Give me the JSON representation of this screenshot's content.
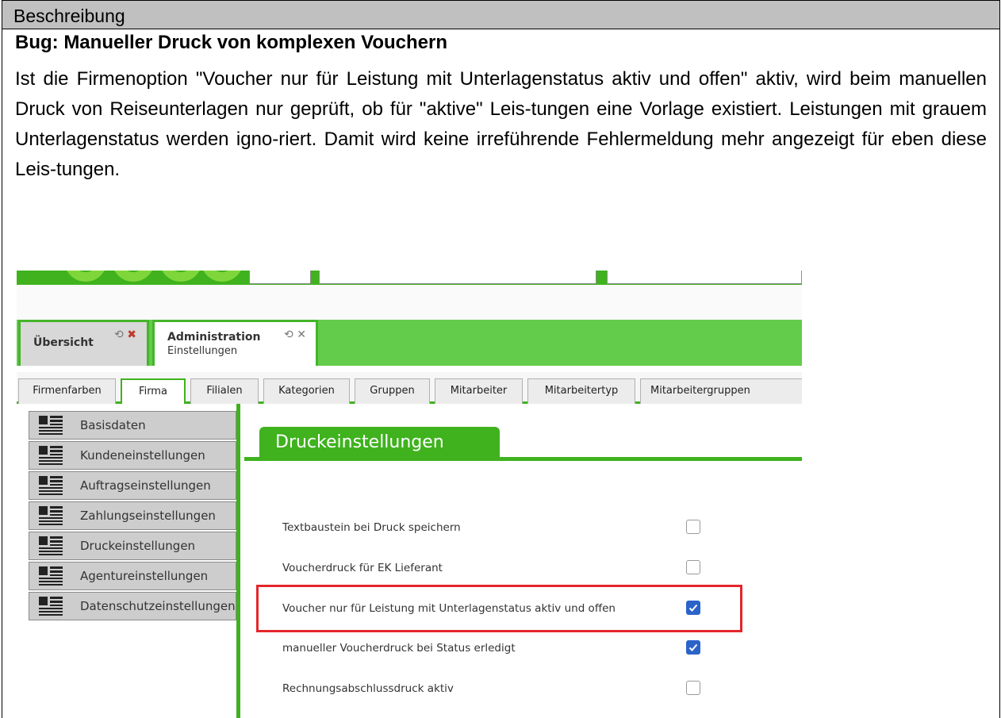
{
  "document": {
    "section_header": "Beschreibung",
    "title": "Bug: Manueller Druck von komplexen Vouchern",
    "body": "Ist die Firmenoption \"Voucher nur für Leistung mit Unterlagenstatus aktiv und offen\" aktiv, wird beim manuellen Druck von Reiseunterlagen nur geprüft, ob für \"aktive\" Leis-tungen eine Vorlage existiert. Leistungen mit grauem Unterlagenstatus werden igno-riert. Damit wird keine irreführende Fehlermeldung mehr angezeigt für eben diese Leis-tungen."
  },
  "screenshot": {
    "doc_tabs": [
      {
        "title": "Übersicht",
        "subtitle": ""
      },
      {
        "title": "Administration",
        "subtitle": "Einstellungen"
      }
    ],
    "sub_tabs": [
      "Firmenfarben",
      "Firma",
      "Filialen",
      "Kategorien",
      "Gruppen",
      "Mitarbeiter",
      "Mitarbeitertyp",
      "Mitarbeitergruppen"
    ],
    "active_sub_tab": "Firma",
    "sidebar": [
      "Basisdaten",
      "Kundeneinstellungen",
      "Auftragseinstellungen",
      "Zahlungseinstellungen",
      "Druckeinstellungen",
      "Agentureinstellungen",
      "Datenschutzeinstellungen"
    ],
    "content_title": "Druckeinstellungen",
    "options": [
      {
        "label": "Textbaustein bei Druck speichern",
        "checked": false
      },
      {
        "label": "Voucherdruck für EK Lieferant",
        "checked": false
      },
      {
        "label": "Voucher nur für Leistung mit Unterlagenstatus aktiv und offen",
        "checked": true
      },
      {
        "label": "manueller Voucherdruck bei Status erledigt",
        "checked": true
      },
      {
        "label": "Rechnungsabschlussdruck aktiv",
        "checked": false
      }
    ],
    "highlighted_option": "Voucher nur für Leistung mit Unterlagenstatus aktiv und offen",
    "colors": {
      "accent_green": "#3fb21e",
      "tab_area_green": "#63cc4a",
      "highlight_red": "#e3262b",
      "checkbox_blue": "#2b63c9"
    }
  }
}
